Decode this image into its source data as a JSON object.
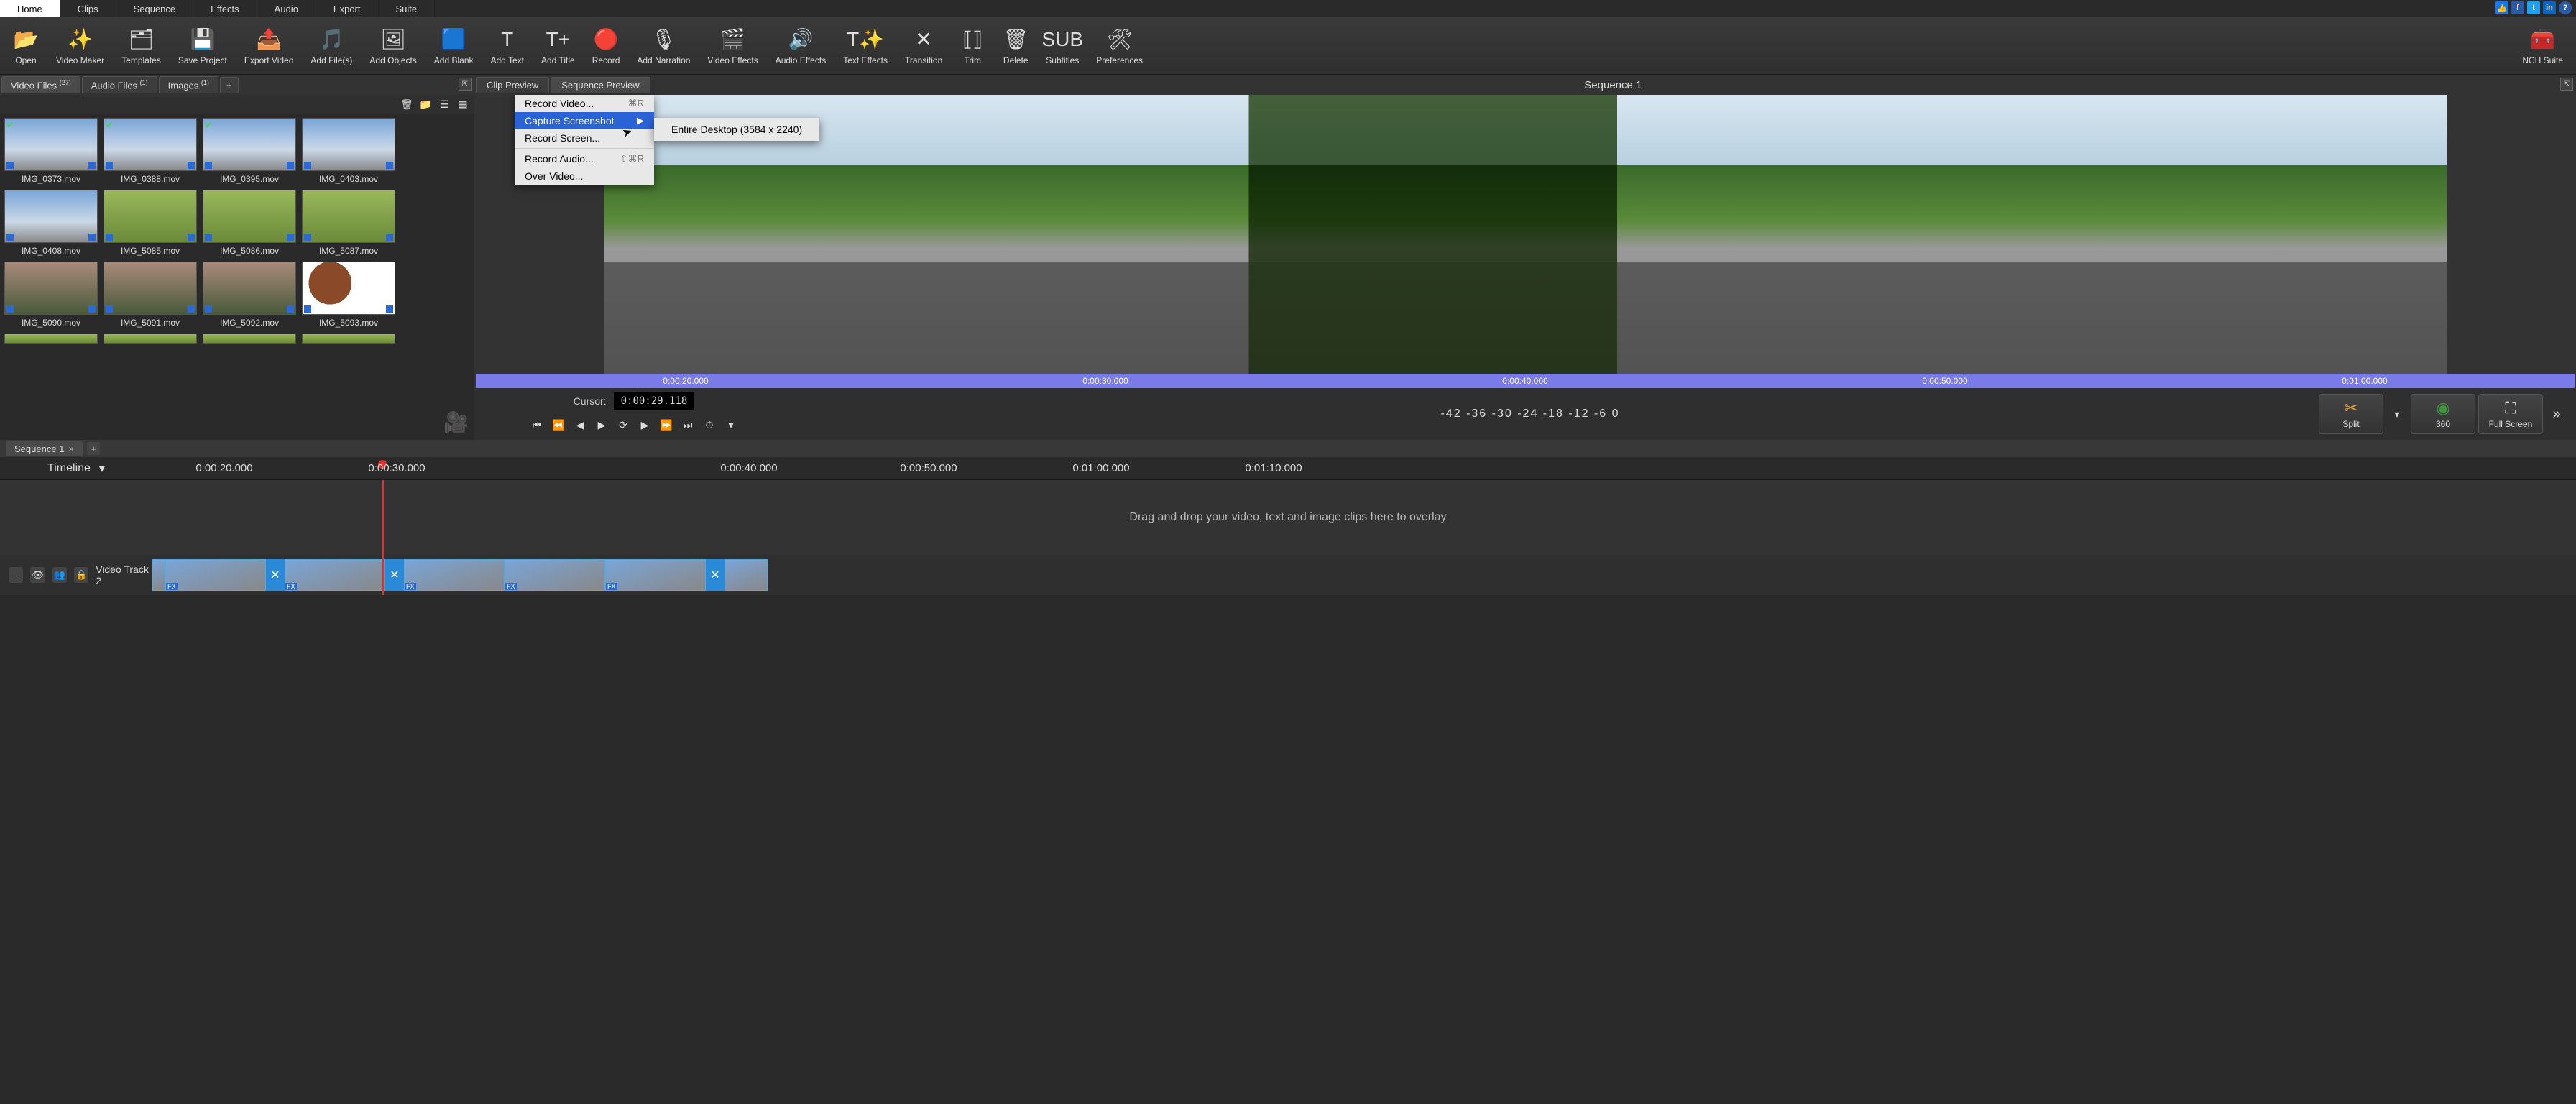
{
  "menubar": {
    "tabs": [
      "Home",
      "Clips",
      "Sequence",
      "Effects",
      "Audio",
      "Export",
      "Suite"
    ],
    "active": 0
  },
  "toolbar": [
    {
      "id": "open",
      "label": "Open"
    },
    {
      "id": "video-maker",
      "label": "Video Maker"
    },
    {
      "id": "templates",
      "label": "Templates"
    },
    {
      "id": "save-project",
      "label": "Save Project"
    },
    {
      "id": "export-video",
      "label": "Export Video"
    },
    {
      "id": "add-files",
      "label": "Add File(s)"
    },
    {
      "id": "add-objects",
      "label": "Add Objects"
    },
    {
      "id": "add-blank",
      "label": "Add Blank"
    },
    {
      "id": "add-text",
      "label": "Add Text"
    },
    {
      "id": "add-title",
      "label": "Add Title"
    },
    {
      "id": "record",
      "label": "Record"
    },
    {
      "id": "add-narration",
      "label": "Add Narration"
    },
    {
      "id": "video-effects",
      "label": "Video Effects"
    },
    {
      "id": "audio-effects",
      "label": "Audio Effects"
    },
    {
      "id": "text-effects",
      "label": "Text Effects"
    },
    {
      "id": "transition",
      "label": "Transition"
    },
    {
      "id": "trim",
      "label": "Trim"
    },
    {
      "id": "delete",
      "label": "Delete"
    },
    {
      "id": "subtitles",
      "label": "Subtitles"
    },
    {
      "id": "preferences",
      "label": "Preferences"
    },
    {
      "id": "nch-suite",
      "label": "NCH Suite"
    }
  ],
  "file_tabs": {
    "video": {
      "label": "Video Files",
      "count": "(27)"
    },
    "audio": {
      "label": "Audio Files",
      "count": "(1)"
    },
    "images": {
      "label": "Images",
      "count": "(1)"
    }
  },
  "preview_tabs": {
    "clip": "Clip Preview",
    "sequence": "Sequence Preview"
  },
  "sequence_title": "Sequence 1",
  "clips": [
    {
      "name": "IMG_0373.mov",
      "checked": true,
      "style": "sky"
    },
    {
      "name": "IMG_0388.mov",
      "checked": true,
      "style": "sky"
    },
    {
      "name": "IMG_0395.mov",
      "checked": true,
      "style": "sky"
    },
    {
      "name": "IMG_0403.mov",
      "checked": false,
      "style": "sky"
    },
    {
      "name": "IMG_0408.mov",
      "checked": false,
      "style": "sky"
    },
    {
      "name": "IMG_5085.mov",
      "checked": false,
      "style": "grass"
    },
    {
      "name": "IMG_5086.mov",
      "checked": false,
      "style": "grass"
    },
    {
      "name": "IMG_5087.mov",
      "checked": false,
      "style": "grass"
    },
    {
      "name": "IMG_5090.mov",
      "checked": false,
      "style": "sunset"
    },
    {
      "name": "IMG_5091.mov",
      "checked": false,
      "style": "sunset"
    },
    {
      "name": "IMG_5092.mov",
      "checked": false,
      "style": "sunset"
    },
    {
      "name": "IMG_5093.mov",
      "checked": false,
      "style": "cow"
    }
  ],
  "context_menu": {
    "items": [
      {
        "label": "Record Video...",
        "shortcut": "⌘R"
      },
      {
        "label": "Capture Screenshot",
        "submenu": true,
        "highlighted": true
      },
      {
        "label": "Record Screen..."
      },
      {
        "sep": true
      },
      {
        "label": "Record Audio...",
        "shortcut": "⇧⌘R"
      },
      {
        "label": "Over Video..."
      }
    ],
    "submenu_item": "Entire Desktop (3584 x 2240)"
  },
  "scrubber_times": [
    "0:00:20.000",
    "0:00:30.000",
    "0:00:40.000",
    "0:00:50.000",
    "0:01:00.000"
  ],
  "cursor": {
    "label": "Cursor:",
    "value": "0:00:29.118"
  },
  "levels": "-42 -36 -30 -24 -18 -12  -6   0",
  "big_buttons": {
    "split": "Split",
    "360": "360",
    "fullscreen": "Full Screen"
  },
  "sequence_tabs": {
    "name": "Sequence 1"
  },
  "timeline": {
    "label": "Timeline",
    "ticks": [
      "0:00:20.000",
      "0:00:30.000",
      "0:00:40.000",
      "0:00:50.000",
      "0:01:00.000",
      "0:01:10.000"
    ]
  },
  "overlay_hint": "Drag and drop your video, text and image clips here to overlay",
  "video_track": {
    "label": "Video Track 2"
  }
}
